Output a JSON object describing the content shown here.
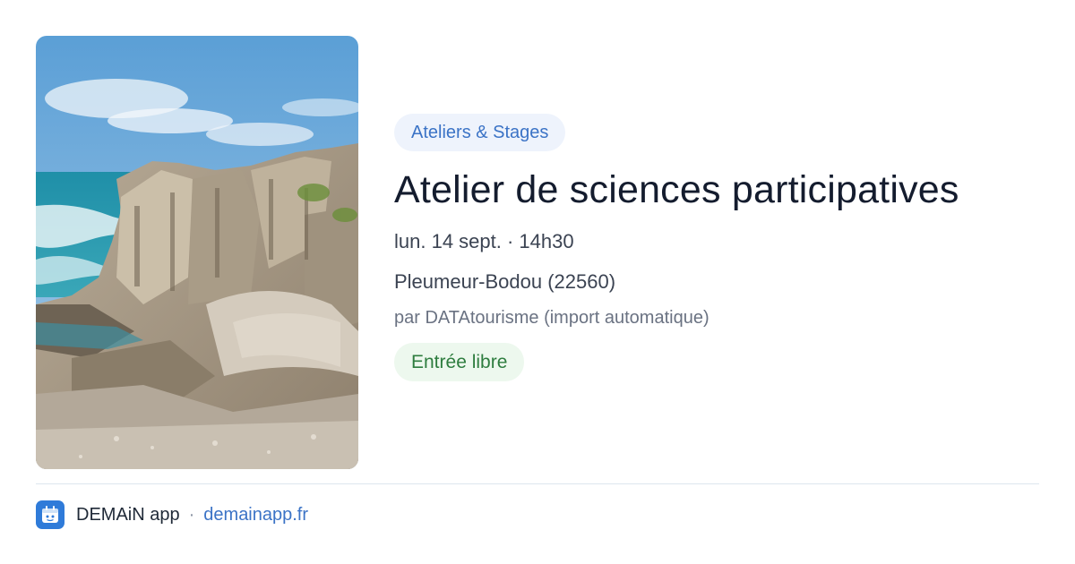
{
  "event": {
    "image": "coastal-rocks-photo",
    "category": "Ateliers & Stages",
    "title": "Atelier de sciences participatives",
    "date": "lun. 14 sept. · 14h30",
    "location": "Pleumeur-Bodou (22560)",
    "author": "par DATAtourisme (import automatique)",
    "price": "Entrée libre"
  },
  "footer": {
    "app_icon": "demain-app-icon",
    "app_name": "DEMAiN app",
    "separator": "·",
    "domain": "demainapp.fr"
  },
  "colors": {
    "accent": "#3b73c6",
    "category_bg": "#eef3fc",
    "price_fg": "#2e7d3f",
    "price_bg": "#edf8ee",
    "app_icon_bg": "#2f7bd9"
  }
}
